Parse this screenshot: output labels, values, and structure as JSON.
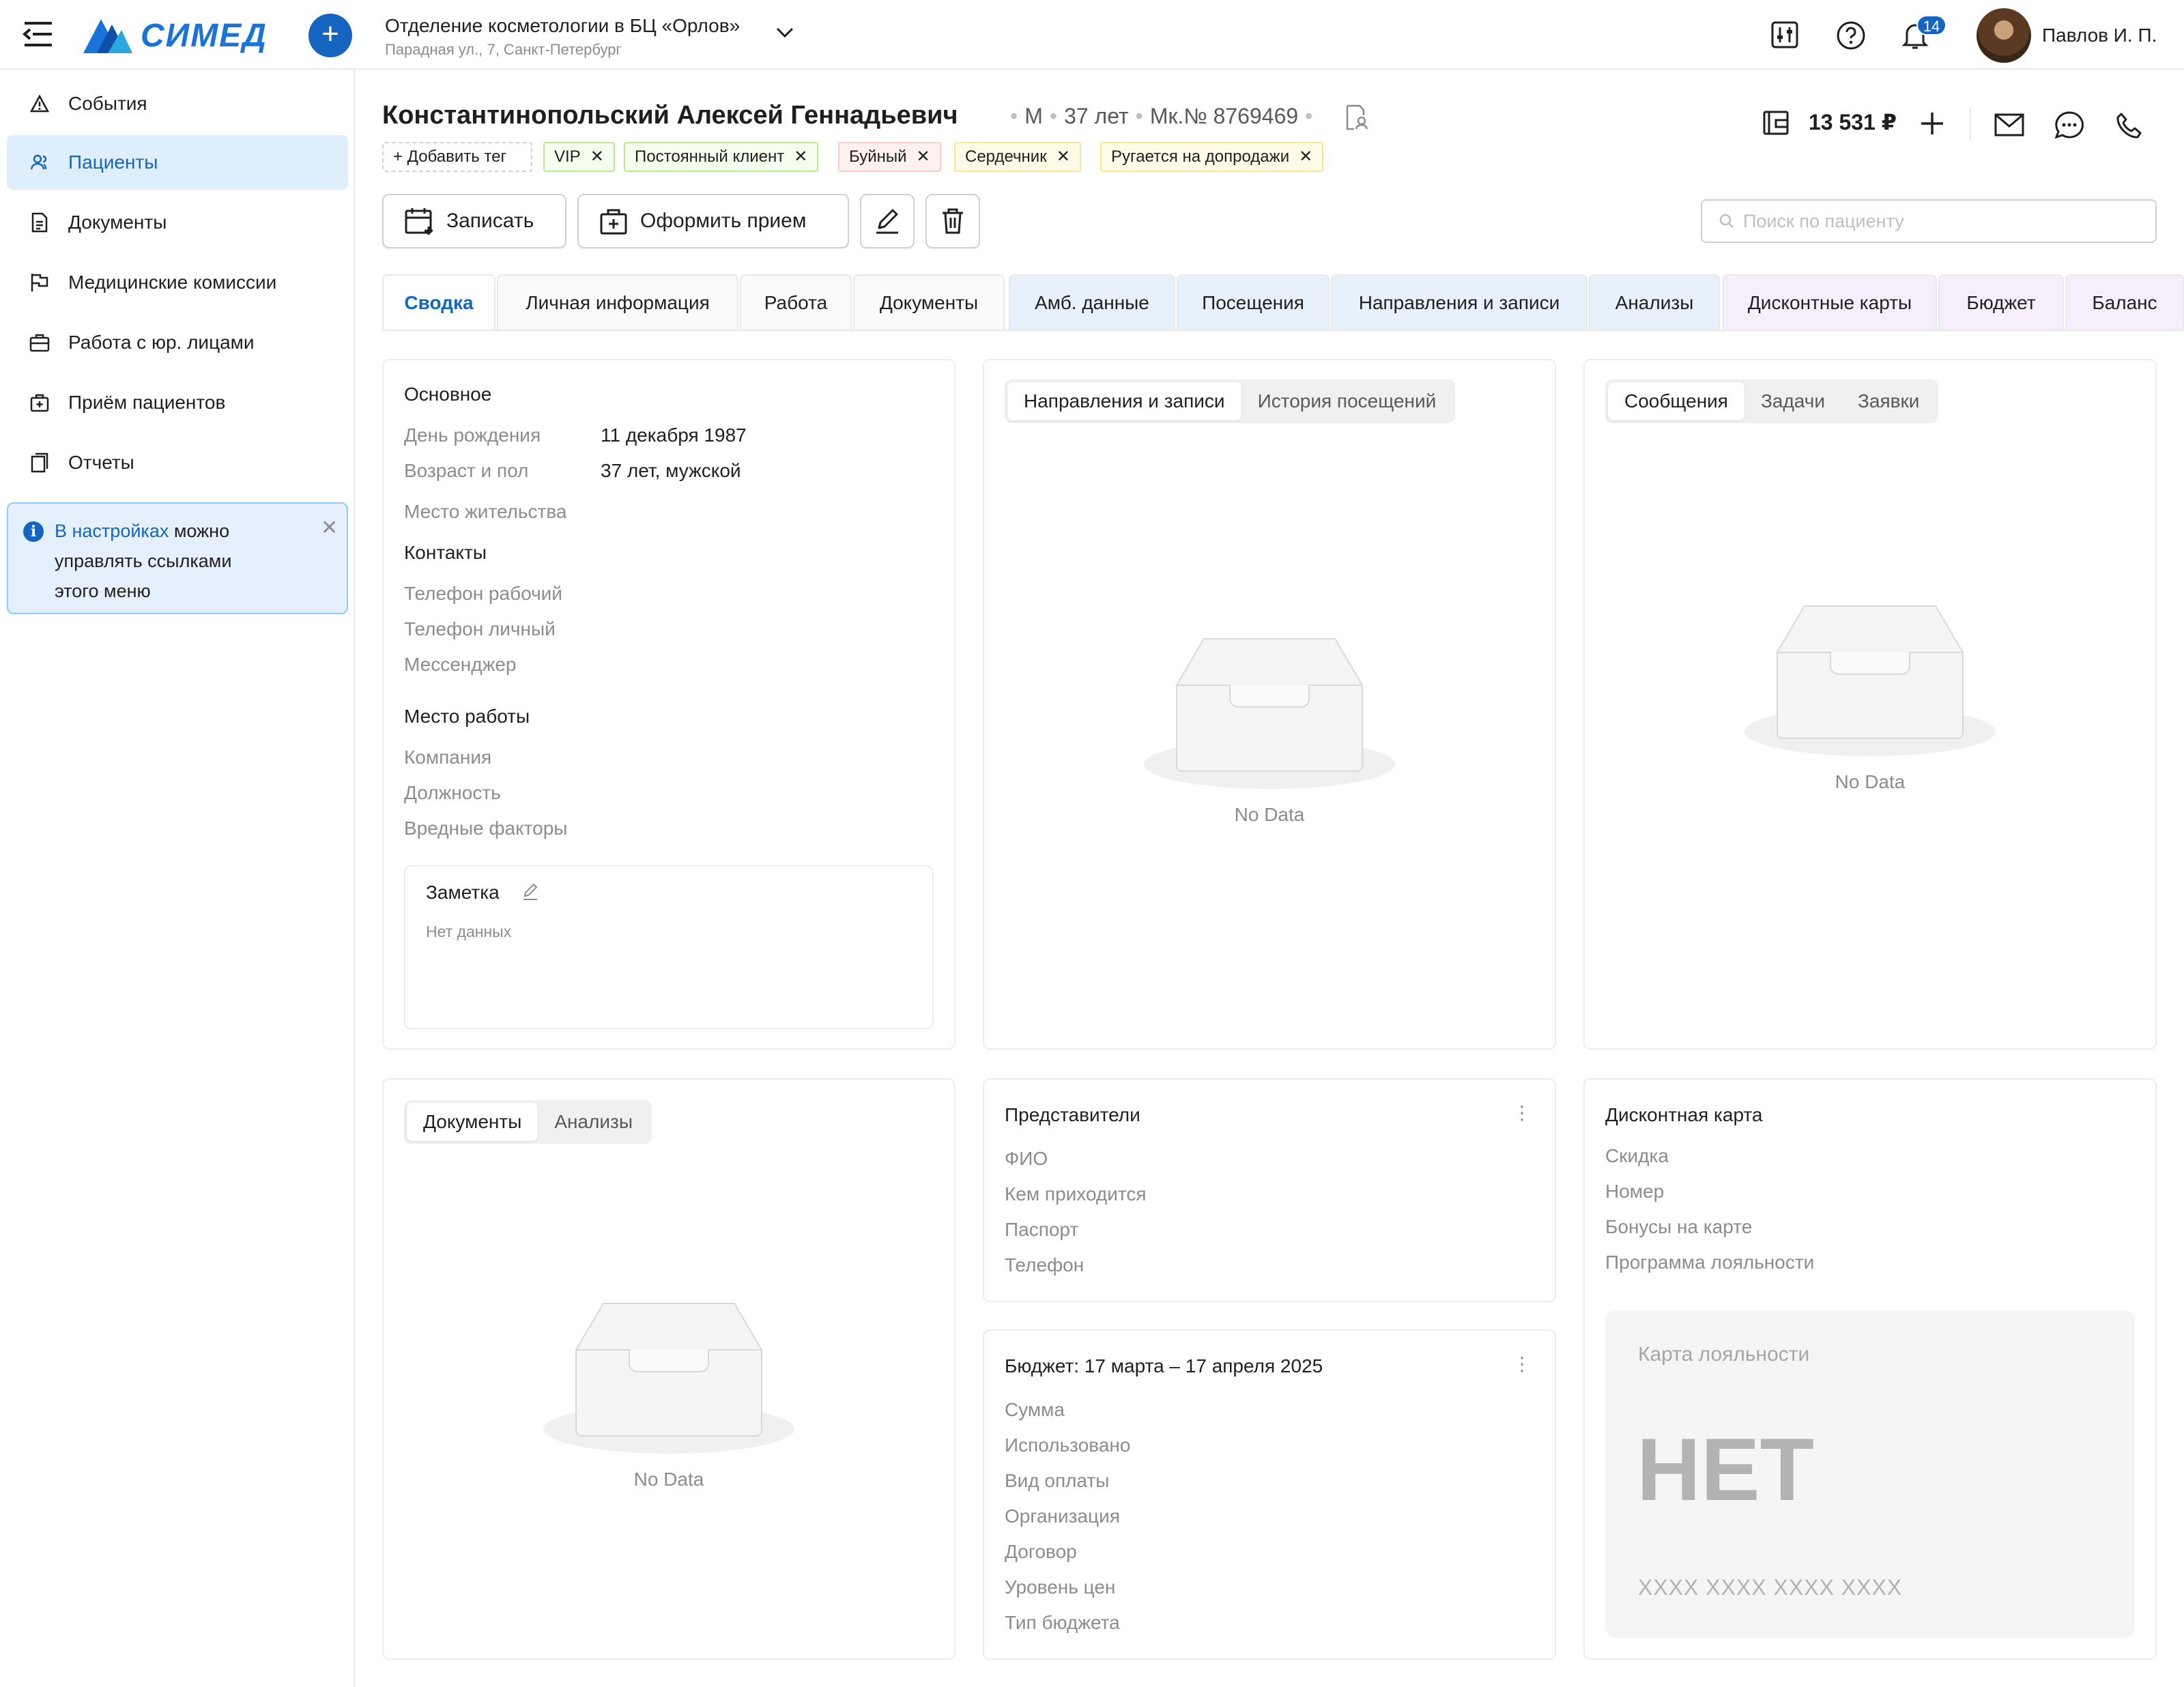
{
  "header": {
    "logo_text": "СИМЕД",
    "department": "Отделение косметологии в БЦ «Орлов»",
    "address": "Парадная ул., 7, Санкт-Петербург",
    "notifications_count": "14",
    "user_name": "Павлов И. П."
  },
  "sidebar": {
    "items": [
      {
        "label": "События",
        "icon": "warning-icon"
      },
      {
        "label": "Пациенты",
        "icon": "patients-icon"
      },
      {
        "label": "Документы",
        "icon": "document-icon"
      },
      {
        "label": "Медицинские комиссии",
        "icon": "flag-icon"
      },
      {
        "label": "Работа с юр. лицами",
        "icon": "briefcase-icon"
      },
      {
        "label": "Приём пациентов",
        "icon": "medical-case-icon"
      },
      {
        "label": "Отчеты",
        "icon": "report-icon"
      }
    ],
    "info": {
      "link": "В настройках",
      "text_1": " можно",
      "text_2": "управлять ссылками",
      "text_3": "этого меню"
    }
  },
  "patient": {
    "name": "Константинопольский Алексей Геннадьевич",
    "sex": "М",
    "age": "37 лет",
    "card_no": "Мк.№ 8769469",
    "balance": "13 531 ₽",
    "add_tag": "+ Добавить тег",
    "tags": [
      {
        "label": "VIP",
        "color": "green"
      },
      {
        "label": "Постоянный клиент",
        "color": "green"
      },
      {
        "label": "Буйный",
        "color": "red"
      },
      {
        "label": "Сердечник",
        "color": "yellow"
      },
      {
        "label": "Ругается на допродажи",
        "color": "yellow"
      }
    ]
  },
  "toolbar": {
    "record_label": "Записать",
    "appointment_label": "Оформить прием",
    "search_placeholder": "Поиск по пациенту"
  },
  "tabs": [
    {
      "label": "Сводка",
      "style": "active"
    },
    {
      "label": "Личная информация",
      "style": "plain"
    },
    {
      "label": "Работа",
      "style": "plain"
    },
    {
      "label": "Документы",
      "style": "plain"
    },
    {
      "label": "Амб. данные",
      "style": "blue"
    },
    {
      "label": "Посещения",
      "style": "blue"
    },
    {
      "label": "Направления и записи",
      "style": "blue"
    },
    {
      "label": "Анализы",
      "style": "blue"
    },
    {
      "label": "Дисконтные карты",
      "style": "purple"
    },
    {
      "label": "Бюджет",
      "style": "purple"
    },
    {
      "label": "Баланс",
      "style": "purple"
    }
  ],
  "main_card": {
    "title": "Основное",
    "birthday_label": "День рождения",
    "birthday_value": "11 декабря 1987",
    "age_label": "Возраст и пол",
    "age_value": "37 лет, мужской",
    "residence_label": "Место жительства",
    "contacts_title": "Контакты",
    "work_phone": "Телефон рабочий",
    "personal_phone": "Телефон личный",
    "messenger": "Мессенджер",
    "work_title": "Место работы",
    "company": "Компания",
    "position": "Должность",
    "hazards": "Вредные факторы",
    "note_title": "Заметка",
    "note_value": "Нет данных"
  },
  "referrals_card": {
    "seg": [
      "Направления и записи",
      "История посещений"
    ],
    "empty": "No Data"
  },
  "messages_card": {
    "seg": [
      "Сообщения",
      "Задачи",
      "Заявки"
    ],
    "empty": "No Data"
  },
  "docs_card": {
    "seg": [
      "Документы",
      "Анализы"
    ],
    "empty": "No Data"
  },
  "representatives": {
    "title": "Представители",
    "fields": [
      "ФИО",
      "Кем приходится",
      "Паспорт",
      "Телефон"
    ]
  },
  "budget": {
    "title": "Бюджет: 17 марта – 17 апреля 2025",
    "fields": [
      "Сумма",
      "Использовано",
      "Вид оплаты",
      "Организация",
      "Договор",
      "Уровень цен",
      "Тип бюджета"
    ]
  },
  "discount": {
    "title": "Дисконтная карта",
    "fields": [
      "Скидка",
      "Номер",
      "Бонусы на карте",
      "Программа лояльности"
    ],
    "card_title": "Карта лояльности",
    "card_big": "НЕТ",
    "card_number": "XXXX XXXX XXXX XXXX"
  }
}
